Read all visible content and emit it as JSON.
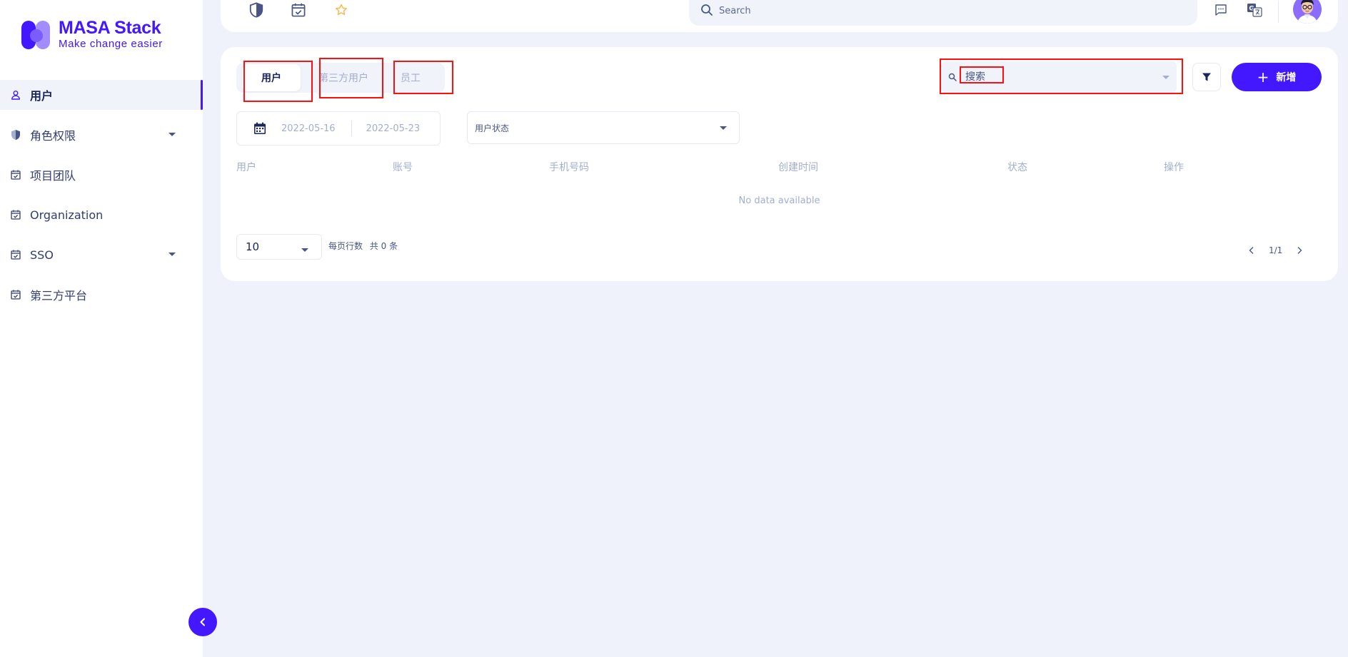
{
  "brand": {
    "title": "MASA Stack",
    "subtitle": "Make change easier",
    "accent": "#4318ff"
  },
  "sidebar": {
    "items": [
      {
        "label": "用户",
        "icon": "user-icon",
        "active": true
      },
      {
        "label": "角色权限",
        "icon": "shield-icon",
        "expandable": true
      },
      {
        "label": "项目团队",
        "icon": "calendar-check-icon"
      },
      {
        "label": "Organization",
        "icon": "calendar-check-icon"
      },
      {
        "label": "SSO",
        "icon": "calendar-check-icon",
        "expandable": true
      },
      {
        "label": "第三方平台",
        "icon": "calendar-check-icon"
      }
    ]
  },
  "topbar": {
    "icons": [
      "shield-icon",
      "calendar-check-icon",
      "star-icon"
    ],
    "search_placeholder": "Search",
    "right_icons": [
      "message-icon",
      "translate-icon"
    ]
  },
  "tabs": [
    {
      "label": "用户",
      "active": true
    },
    {
      "label": "第三方用户",
      "active": false
    },
    {
      "label": "员工",
      "active": false
    }
  ],
  "search": {
    "placeholder": "搜索"
  },
  "add_button": {
    "label": "新增"
  },
  "date_range": {
    "start": "2022-05-16",
    "end": "2022-05-23"
  },
  "status_select": {
    "placeholder": "用户状态"
  },
  "table": {
    "columns": [
      "用户",
      "账号",
      "手机号码",
      "创建时间",
      "状态",
      "操作"
    ],
    "empty_text": "No data available"
  },
  "pagination": {
    "page_size": "10",
    "rows_per_page_label": "每页行数",
    "total_label": "共 0 条",
    "page_indicator": "1/1"
  }
}
